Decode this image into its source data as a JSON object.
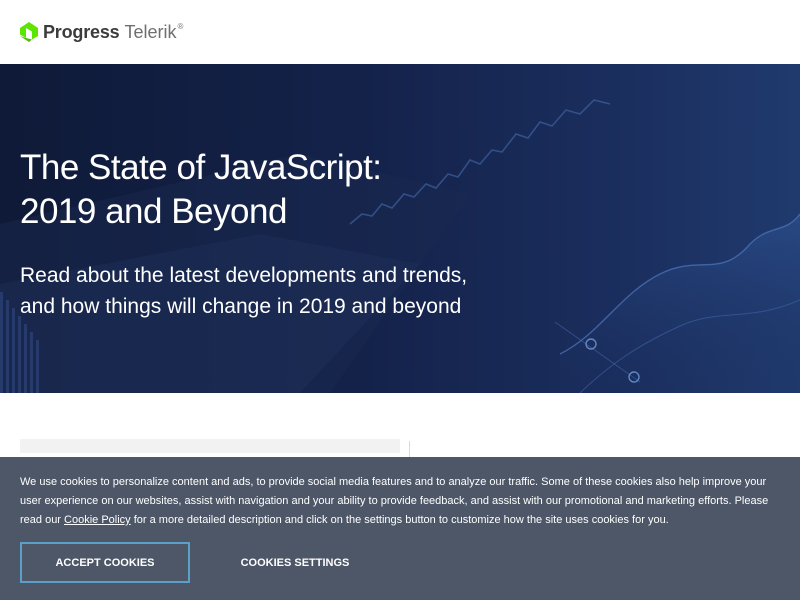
{
  "header": {
    "logo": {
      "brand": "Progress",
      "product": "Telerik",
      "trademark": "®"
    },
    "logo_color": "#5ce500"
  },
  "hero": {
    "title_lines": [
      "The State of JavaScript:",
      "2019 and Beyond"
    ],
    "subtitle_lines": [
      "Read about the latest developments and trends,",
      "and how things will change in 2019 and beyond"
    ]
  },
  "cookie_banner": {
    "text_before_link": "We use cookies to personalize content and ads, to provide social media features and to analyze our traffic. Some of these cookies also help improve your user experience on our websites, assist with navigation and your ability to provide feedback, and assist with our promotional and marketing efforts. Please read our ",
    "link_text": "Cookie Policy",
    "text_after_link": " for a more detailed description and click on the settings button to customize how the site uses cookies for you.",
    "accept_label": "ACCEPT COOKIES",
    "settings_label": "COOKIES SETTINGS",
    "background_color": "#4d5767",
    "accept_border_color": "#5aa0c8"
  }
}
